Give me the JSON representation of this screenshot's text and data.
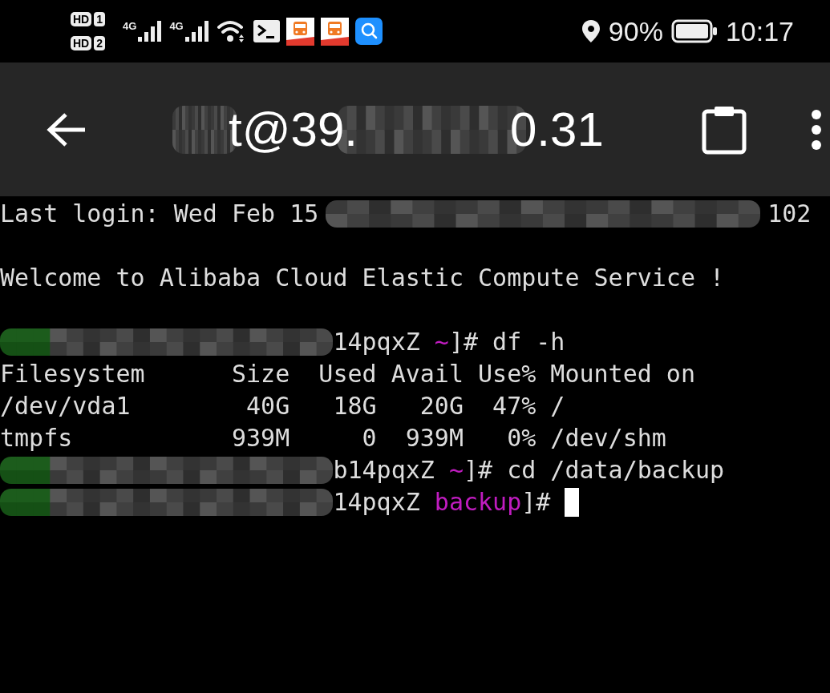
{
  "status_bar": {
    "sim_slots": [
      {
        "label": "HD",
        "slot": "1"
      },
      {
        "label": "HD",
        "slot": "2"
      }
    ],
    "networks": [
      {
        "type": "4G"
      },
      {
        "type": "4G"
      }
    ],
    "battery": "90%",
    "time": "10:17"
  },
  "app_bar": {
    "title": [
      {
        "kind": "redacted"
      },
      {
        "kind": "text",
        "text": "t@39."
      },
      {
        "kind": "redacted"
      },
      {
        "kind": "text",
        "text": "0.31"
      }
    ]
  },
  "terminal": {
    "lines": [
      {
        "kind": "login",
        "segments": [
          {
            "kind": "text",
            "text": "Last login: Wed Feb 15"
          },
          {
            "kind": "redacted"
          },
          {
            "kind": "text",
            "text": "102"
          }
        ]
      },
      {
        "kind": "blank"
      },
      {
        "kind": "plain",
        "segments": [
          {
            "kind": "text",
            "text": "Welcome to Alibaba Cloud Elastic Compute Service !"
          }
        ]
      },
      {
        "kind": "blank"
      },
      {
        "kind": "prompt",
        "segments": [
          {
            "kind": "redacted"
          },
          {
            "kind": "text",
            "text": "14pqxZ "
          },
          {
            "kind": "path",
            "text": "~"
          },
          {
            "kind": "text",
            "text": "]# df -h"
          }
        ]
      },
      {
        "kind": "plain",
        "segments": [
          {
            "kind": "text",
            "text": "Filesystem      Size  Used Avail Use% Mounted on"
          }
        ]
      },
      {
        "kind": "plain",
        "segments": [
          {
            "kind": "text",
            "text": "/dev/vda1        40G   18G   20G  47% /"
          }
        ]
      },
      {
        "kind": "plain",
        "segments": [
          {
            "kind": "text",
            "text": "tmpfs           939M     0  939M   0% /dev/shm"
          }
        ]
      },
      {
        "kind": "prompt",
        "segments": [
          {
            "kind": "redacted"
          },
          {
            "kind": "text",
            "text": "b14pqxZ "
          },
          {
            "kind": "path",
            "text": "~"
          },
          {
            "kind": "text",
            "text": "]# cd /data/backup"
          }
        ]
      },
      {
        "kind": "prompt",
        "segments": [
          {
            "kind": "redacted"
          },
          {
            "kind": "text",
            "text": "14pqxZ "
          },
          {
            "kind": "path",
            "text": "backup"
          },
          {
            "kind": "text",
            "text": "]# "
          },
          {
            "kind": "cursor"
          }
        ]
      }
    ]
  }
}
